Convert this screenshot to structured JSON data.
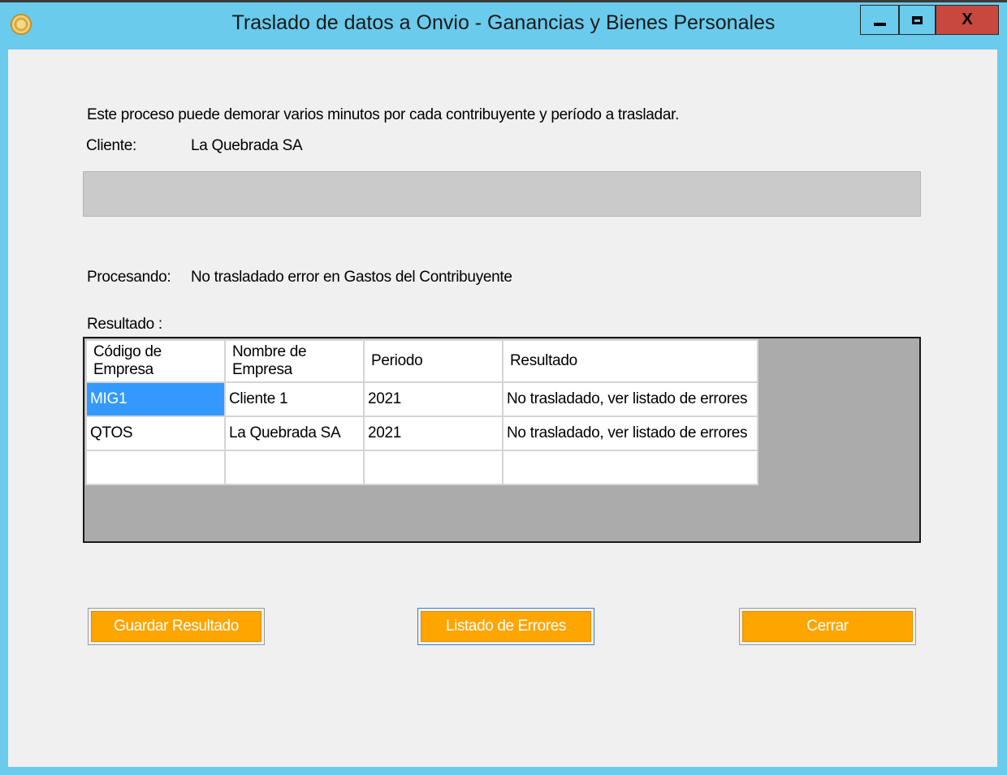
{
  "window": {
    "title": "Traslado de datos a Onvio - Ganancias y Bienes Personales",
    "close_glyph": "X",
    "icon": "app-logo-icon"
  },
  "info": {
    "message": "Este proceso puede demorar varios minutos por cada contribuyente y período a trasladar.",
    "client_label": "Cliente:",
    "client_value": "La Quebrada SA",
    "processing_label": "Procesando:",
    "processing_value": "No trasladado error en Gastos del Contribuyente",
    "result_label": "Resultado :"
  },
  "progress": {
    "value": 0
  },
  "grid": {
    "columns": [
      "Código de Empresa",
      "Nombre de Empresa",
      "Periodo",
      "Resultado"
    ],
    "rows": [
      [
        "MIG1",
        "Cliente 1",
        "2021",
        "No trasladado, ver listado de errores"
      ],
      [
        "QTOS",
        "La Quebrada SA",
        "2021",
        "No trasladado, ver listado de errores"
      ],
      [
        "",
        "",
        "",
        ""
      ]
    ]
  },
  "buttons": {
    "save": "Guardar Resultado",
    "errors": "Listado de Errores",
    "close": "Cerrar"
  },
  "colors": {
    "titlebar": "#6acbec",
    "button_orange": "#ffa500",
    "selection": "#3399ff",
    "close_button": "#c8483f"
  }
}
